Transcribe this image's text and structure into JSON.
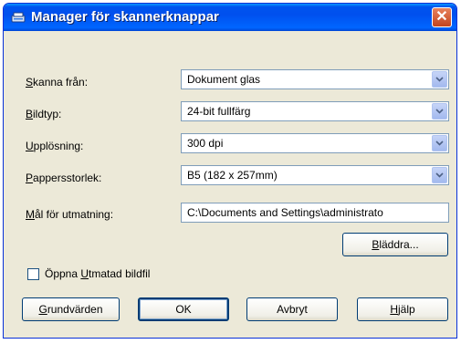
{
  "window": {
    "title": "Manager för skannerknappar",
    "close_glyph": "✕"
  },
  "fields": {
    "scan_from": {
      "label_first": "S",
      "label_rest": "kanna från:",
      "value": "Dokument glas"
    },
    "image_type": {
      "label_first": "B",
      "label_rest": "ildtyp:",
      "value": "24-bit fullfärg"
    },
    "resolution": {
      "label_first": "U",
      "label_rest": "pplösning:",
      "value": "300 dpi"
    },
    "paper_size": {
      "label_first": "P",
      "label_rest": "appersstorlek:",
      "value": "B5 (182 x 257mm)"
    },
    "save_target": {
      "label_first": "M",
      "label_rest": "ål för utmatning:",
      "value": "C:\\Documents and Settings\\administrato"
    }
  },
  "buttons": {
    "browse_first": "B",
    "browse_rest": "läddra...",
    "defaults_first": "G",
    "defaults_rest": "rundvärden",
    "ok": "OK",
    "cancel": "Avbryt",
    "help_first": "H",
    "help_rest": "jälp"
  },
  "checkbox": {
    "label_pre": "Öppna ",
    "label_u": "U",
    "label_rest": "tmatad bildfil",
    "checked": false
  },
  "icons": {
    "app": "scanner-app-icon",
    "close": "close-icon",
    "dropdown": "chevron-down-icon"
  },
  "colors": {
    "titlebar": "#0053ee",
    "dialog_bg": "#ece9d8",
    "close_button": "#c2441e"
  }
}
